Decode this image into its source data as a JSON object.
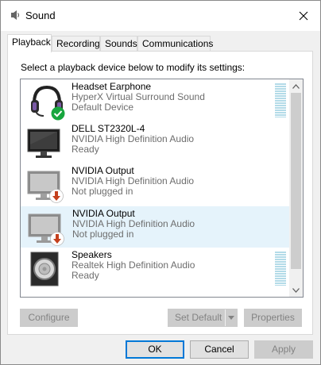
{
  "window": {
    "title": "Sound",
    "close_glyph": "✕"
  },
  "tabs": [
    {
      "label": "Playback",
      "active": true
    },
    {
      "label": "Recording",
      "active": false
    },
    {
      "label": "Sounds",
      "active": false
    },
    {
      "label": "Communications",
      "active": false
    }
  ],
  "playback": {
    "instruction": "Select a playback device below to modify its settings:",
    "devices": [
      {
        "name": "Headset Earphone",
        "driver": "HyperX Virtual Surround Sound",
        "status": "Default Device",
        "icon": "headset-icon",
        "badge": "default-check-badge-icon",
        "selected": false
      },
      {
        "name": "DELL ST2320L-4",
        "driver": "NVIDIA High Definition Audio",
        "status": "Ready",
        "icon": "monitor-icon",
        "badge": null,
        "selected": false
      },
      {
        "name": "NVIDIA Output",
        "driver": "NVIDIA High Definition Audio",
        "status": "Not plugged in",
        "icon": "monitor-disabled-icon",
        "badge": "unplugged-arrow-badge-icon",
        "selected": false
      },
      {
        "name": "NVIDIA Output",
        "driver": "NVIDIA High Definition Audio",
        "status": "Not plugged in",
        "icon": "monitor-disabled-icon",
        "badge": "unplugged-arrow-badge-icon",
        "selected": true
      },
      {
        "name": "Speakers",
        "driver": "Realtek High Definition Audio",
        "status": "Ready",
        "icon": "speaker-icon",
        "badge": null,
        "selected": false
      }
    ],
    "buttons": {
      "configure": "Configure",
      "set_default": "Set Default",
      "properties": "Properties"
    }
  },
  "footer": {
    "ok": "OK",
    "cancel": "Cancel",
    "apply": "Apply"
  },
  "colors": {
    "accent": "#0078d7",
    "selection": "#e5f3fb",
    "default_check": "#17a63e",
    "unplugged_arrow": "#c4401d",
    "meter": "#b3dbe8"
  }
}
